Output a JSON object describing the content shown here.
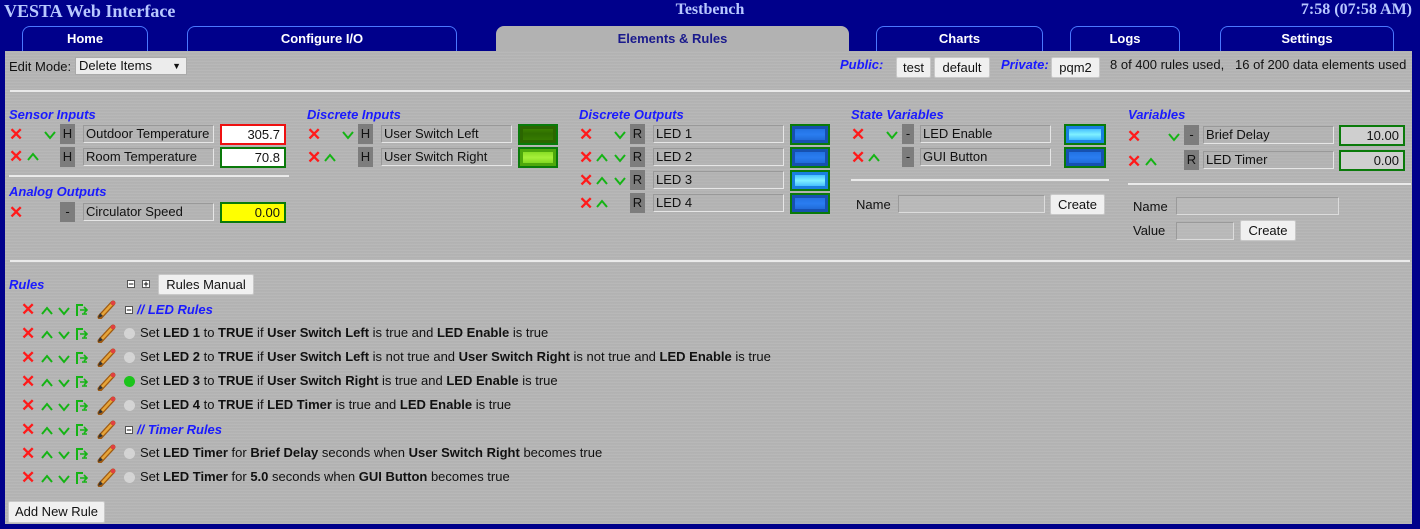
{
  "header": {
    "app_title": "VESTA Web Interface",
    "site_name": "Testbench",
    "clock": "7:58 (07:58 AM)"
  },
  "tabs": [
    {
      "label": "Home",
      "active": false
    },
    {
      "label": "Configure I/O",
      "active": false
    },
    {
      "label": "Elements & Rules",
      "active": true
    },
    {
      "label": "Charts",
      "active": false
    },
    {
      "label": "Logs",
      "active": false
    },
    {
      "label": "Settings",
      "active": false
    }
  ],
  "toolbar": {
    "edit_mode_label": "Edit Mode:",
    "edit_mode_value": "Delete Items",
    "public_label": "Public:",
    "public_buttons": [
      "test",
      "default"
    ],
    "private_label": "Private:",
    "private_buttons": [
      "pqm2"
    ],
    "usage_text": "8 of 400 rules used,   16 of 200 data elements used"
  },
  "sensor_inputs": {
    "title": "Sensor Inputs",
    "items": [
      {
        "name": "Outdoor Temperature",
        "mode": "H",
        "value": "305.7",
        "alert": true
      },
      {
        "name": "Room Temperature",
        "mode": "H",
        "value": "70.8",
        "alert": false
      }
    ]
  },
  "analog_outputs": {
    "title": "Analog Outputs",
    "items": [
      {
        "name": "Circulator Speed",
        "mode": "-",
        "value": "0.00"
      }
    ]
  },
  "discrete_inputs": {
    "title": "Discrete Inputs",
    "items": [
      {
        "name": "User Switch Left",
        "mode": "H",
        "state": "off"
      },
      {
        "name": "User Switch Right",
        "mode": "H",
        "state": "on"
      }
    ]
  },
  "discrete_outputs": {
    "title": "Discrete Outputs",
    "items": [
      {
        "name": "LED 1",
        "mode": "R",
        "state": "off"
      },
      {
        "name": "LED 2",
        "mode": "R",
        "state": "off"
      },
      {
        "name": "LED 3",
        "mode": "R",
        "state": "on"
      },
      {
        "name": "LED 4",
        "mode": "R",
        "state": "off"
      }
    ]
  },
  "state_variables": {
    "title": "State Variables",
    "items": [
      {
        "name": "LED Enable",
        "mode": "-",
        "state": "on"
      },
      {
        "name": "GUI Button",
        "mode": "-",
        "state": "off"
      }
    ],
    "name_label": "Name",
    "name_value": "",
    "create_label": "Create"
  },
  "variables": {
    "title": "Variables",
    "items": [
      {
        "name": "Brief Delay",
        "mode": "-",
        "value": "10.00"
      },
      {
        "name": "LED Timer",
        "mode": "R",
        "value": "0.00"
      }
    ],
    "name_label": "Name",
    "name_value": "",
    "value_label": "Value",
    "value_value": "",
    "create_label": "Create"
  },
  "rules": {
    "title": "Rules",
    "manual_label": "Rules Manual",
    "collapse_all": "−",
    "expand_all": "+",
    "items": [
      {
        "type": "comment",
        "text": "// LED Rules"
      },
      {
        "type": "rule",
        "active": false,
        "parts": [
          [
            "Set ",
            false
          ],
          [
            "LED 1",
            true
          ],
          [
            " to ",
            false
          ],
          [
            "TRUE",
            true
          ],
          [
            " if ",
            false
          ],
          [
            "User Switch Left",
            true
          ],
          [
            " is true and ",
            false
          ],
          [
            "LED Enable",
            true
          ],
          [
            " is true",
            false
          ]
        ]
      },
      {
        "type": "rule",
        "active": false,
        "parts": [
          [
            "Set ",
            false
          ],
          [
            "LED 2",
            true
          ],
          [
            " to ",
            false
          ],
          [
            "TRUE",
            true
          ],
          [
            " if ",
            false
          ],
          [
            "User Switch Left",
            true
          ],
          [
            " is not true and ",
            false
          ],
          [
            "User Switch Right",
            true
          ],
          [
            " is not true and ",
            false
          ],
          [
            "LED Enable",
            true
          ],
          [
            " is true",
            false
          ]
        ]
      },
      {
        "type": "rule",
        "active": true,
        "parts": [
          [
            "Set ",
            false
          ],
          [
            "LED 3",
            true
          ],
          [
            " to ",
            false
          ],
          [
            "TRUE",
            true
          ],
          [
            " if ",
            false
          ],
          [
            "User Switch Right",
            true
          ],
          [
            " is true and ",
            false
          ],
          [
            "LED Enable",
            true
          ],
          [
            " is true",
            false
          ]
        ]
      },
      {
        "type": "rule",
        "active": false,
        "parts": [
          [
            "Set ",
            false
          ],
          [
            "LED 4",
            true
          ],
          [
            " to ",
            false
          ],
          [
            "TRUE",
            true
          ],
          [
            " if ",
            false
          ],
          [
            "LED Timer",
            true
          ],
          [
            " is true and ",
            false
          ],
          [
            "LED Enable",
            true
          ],
          [
            " is true",
            false
          ]
        ]
      },
      {
        "type": "comment",
        "text": "// Timer Rules"
      },
      {
        "type": "rule",
        "active": false,
        "parts": [
          [
            "Set ",
            false
          ],
          [
            "LED Timer",
            true
          ],
          [
            " for ",
            false
          ],
          [
            "Brief Delay",
            true
          ],
          [
            " seconds when ",
            false
          ],
          [
            "User Switch Right",
            true
          ],
          [
            " becomes true",
            false
          ]
        ]
      },
      {
        "type": "rule",
        "active": false,
        "parts": [
          [
            "Set ",
            false
          ],
          [
            "LED Timer",
            true
          ],
          [
            " for ",
            false
          ],
          [
            "5.0",
            true
          ],
          [
            " seconds when ",
            false
          ],
          [
            "GUI Button",
            true
          ],
          [
            " becomes true",
            false
          ]
        ]
      }
    ],
    "add_rule_label": "Add New Rule"
  },
  "icons": {
    "delete": "✕",
    "up": "chevron-up",
    "down": "chevron-down",
    "move": "move-rule",
    "edit": "pencil"
  },
  "colors": {
    "background": "#00008b",
    "panel": "#b4b4b4",
    "section_title": "#1a1aff",
    "delete_red": "#ff1a1a",
    "arrow_green": "#14b414",
    "value_border_ok": "#0a7a0a",
    "value_border_alert": "#ee1111",
    "analog_value_bg": "#ffff00",
    "rule_active": "#1bc41b"
  }
}
